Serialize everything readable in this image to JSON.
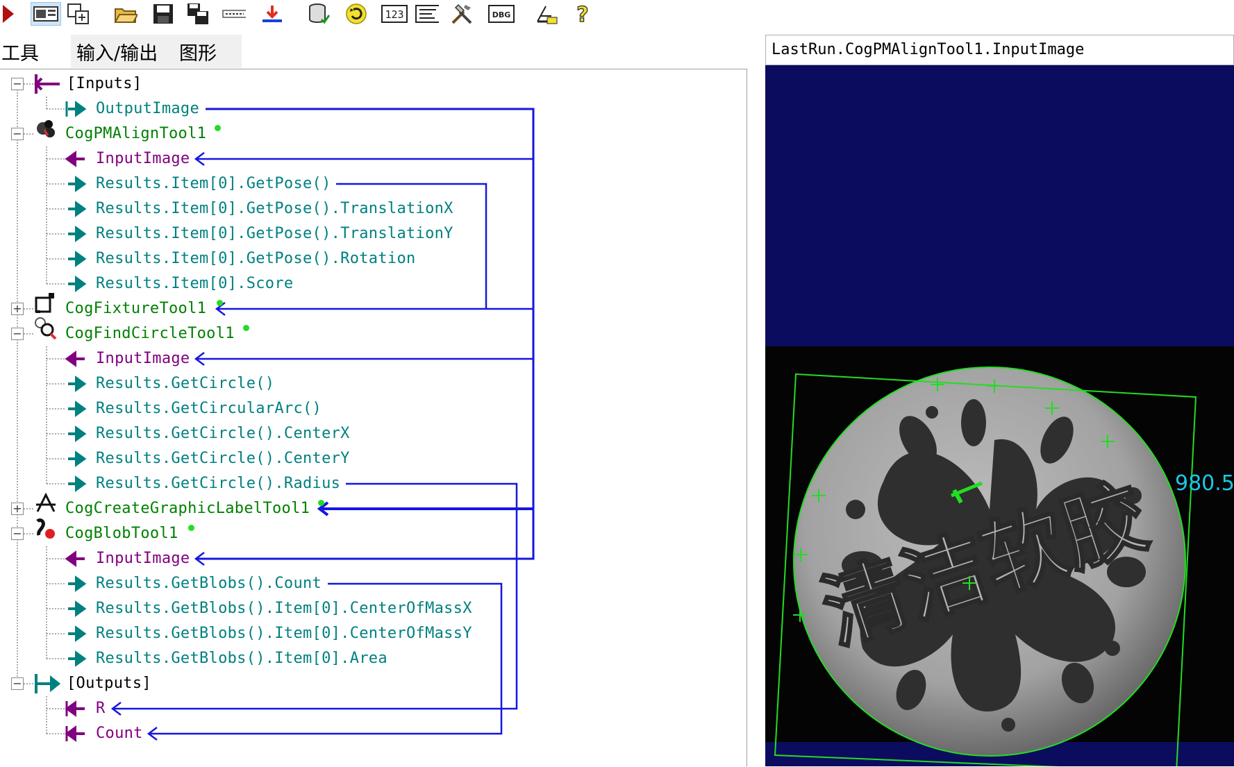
{
  "toolbar": {
    "icons": [
      "run-icon",
      "toggle-view-icon",
      "tool-options-icon",
      "open-folder-icon",
      "save-icon",
      "save-as-icon",
      "link-icon",
      "import-icon",
      "database-icon",
      "refresh-icon",
      "numeric-icon",
      "terminal-icon",
      "tools-icon",
      "debug-icon",
      "measure-icon",
      "help-icon"
    ],
    "numeric_label": "123",
    "debug_label": "DBG",
    "help_label": "?"
  },
  "tabs": {
    "tools": "工具",
    "io": "输入/输出",
    "graphics": "图形"
  },
  "tree": {
    "inputs": {
      "label": "[Inputs]",
      "children": [
        "OutputImage"
      ]
    },
    "pm_align": {
      "label": "CogPMAlignTool1",
      "children": [
        "InputImage",
        "Results.Item[0].GetPose()",
        "Results.Item[0].GetPose().TranslationX",
        "Results.Item[0].GetPose().TranslationY",
        "Results.Item[0].GetPose().Rotation",
        "Results.Item[0].Score"
      ]
    },
    "fixture": {
      "label": "CogFixtureTool1"
    },
    "find_circle": {
      "label": "CogFindCircleTool1",
      "children": [
        "InputImage",
        "Results.GetCircle()",
        "Results.GetCircularArc()",
        "Results.GetCircle().CenterX",
        "Results.GetCircle().CenterY",
        "Results.GetCircle().Radius"
      ]
    },
    "graphic_label": {
      "label": "CogCreateGraphicLabelTool1"
    },
    "blob": {
      "label": "CogBlobTool1",
      "children": [
        "InputImage",
        "Results.GetBlobs().Count",
        "Results.GetBlobs().Item[0].CenterOfMassX",
        "Results.GetBlobs().Item[0].CenterOfMassY",
        "Results.GetBlobs().Item[0].Area"
      ]
    },
    "outputs": {
      "label": "[Outputs]",
      "children": [
        "R",
        "Count"
      ]
    },
    "toggles": {
      "minus": "−",
      "plus": "+"
    }
  },
  "viewer": {
    "title": "LastRun.CogPMAlignTool1.InputImage",
    "measure_label": "980.5",
    "logo_text": "清洁软胶",
    "colors": {
      "background": "#0b0c5e",
      "graphics": "#22dd22",
      "label": "#19c8e8"
    }
  }
}
